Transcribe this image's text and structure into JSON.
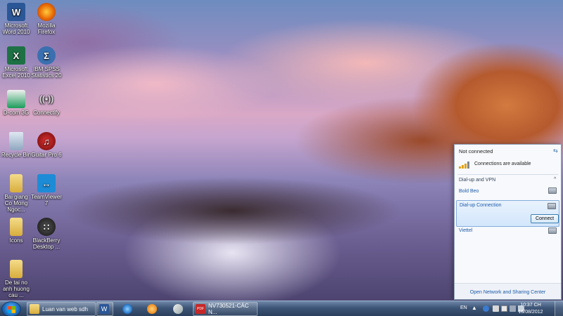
{
  "desktop_icons": [
    {
      "label": "Microsoft Word 2010",
      "icon": "word-icon",
      "color": "#2b5797",
      "glyph": "W"
    },
    {
      "label": "Mozilla Firefox",
      "icon": "firefox-icon",
      "color": "#e66000",
      "glyph": "●"
    },
    {
      "label": "Microsoft Excel 2010",
      "icon": "excel-icon",
      "color": "#1e7145",
      "glyph": "X"
    },
    {
      "label": "IBM SPSS Statistics 20",
      "icon": "spss-icon",
      "color": "#3a6fb0",
      "glyph": "Σ"
    },
    {
      "label": "D-com 3G",
      "icon": "dcom-icon",
      "color": "#1b9c5a",
      "glyph": "○"
    },
    {
      "label": "Connectify",
      "icon": "connectify-icon",
      "color": "#6b6b6b",
      "glyph": ")))"
    },
    {
      "label": "Recycle Bin",
      "icon": "recycle-bin-icon",
      "color": "#9ab0c8",
      "glyph": "♲"
    },
    {
      "label": "Guitar Pro 6",
      "icon": "guitar-pro-icon",
      "color": "#b01818",
      "glyph": "♫"
    },
    {
      "label": "Bai giang Co Mong Ngoc...",
      "icon": "folder-icon",
      "color": "#e3c25c",
      "glyph": ""
    },
    {
      "label": "TeamViewer 7",
      "icon": "teamviewer-icon",
      "color": "#1d8bd6",
      "glyph": "↔"
    },
    {
      "label": "Icons",
      "icon": "folder-icon",
      "color": "#e3c25c",
      "glyph": ""
    },
    {
      "label": "BlackBerry Desktop ...",
      "icon": "blackberry-icon",
      "color": "#222222",
      "glyph": "∷"
    },
    {
      "label": "De tai no anh huong cau ...",
      "icon": "folder-icon",
      "color": "#e3c25c",
      "glyph": ""
    }
  ],
  "taskbar": {
    "start_label": "Start",
    "windows": [
      {
        "label": "Luan van web sdh",
        "icon": "folder-icon",
        "color": "#e3c25c"
      },
      {
        "label": "",
        "icon": "word-icon",
        "color": "#2b5797"
      },
      {
        "label": "",
        "icon": "internet-explorer-icon",
        "color": "#3a8fd9"
      },
      {
        "label": "",
        "icon": "media-player-icon",
        "color": "#f08c1e"
      },
      {
        "label": "",
        "icon": "snipping-tool-icon",
        "color": "#c8c8c8"
      },
      {
        "label": "NV730521-CÁC N...",
        "icon": "pdf-icon",
        "color": "#c62828"
      }
    ],
    "tray": {
      "language": "EN",
      "time": "10:37 CH",
      "date": "16/08/2012"
    }
  },
  "network_panel": {
    "status": "Not connected",
    "availability": "Connections are available",
    "section_title": "Dial-up and VPN",
    "connections": [
      {
        "name": "Bold Beo"
      },
      {
        "name": "Dial-up Connection",
        "action": "Connect"
      },
      {
        "name": "Viettel"
      }
    ],
    "footer_link": "Open Network and Sharing Center"
  }
}
